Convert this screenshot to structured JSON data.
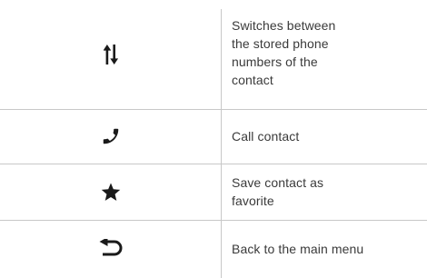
{
  "rows": [
    {
      "icon": "swap-updown-icon",
      "description": "Switches between the stored phone numbers of the contact"
    },
    {
      "icon": "phone-icon",
      "description": "Call contact"
    },
    {
      "icon": "star-icon",
      "description": "Save contact as favorite"
    },
    {
      "icon": "back-return-icon",
      "description": "Back to the main menu"
    }
  ],
  "colors": {
    "icon": "#1a1a1a",
    "text": "#3a3a3a",
    "divider": "#c8c8c8"
  }
}
